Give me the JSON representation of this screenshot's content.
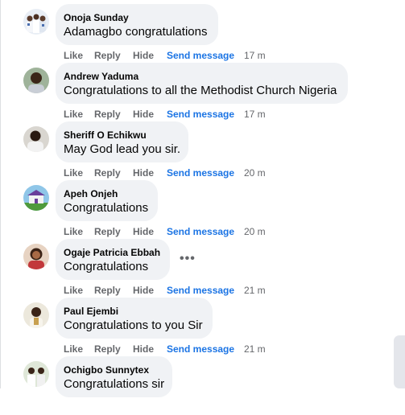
{
  "actions": {
    "like": "Like",
    "reply": "Reply",
    "hide": "Hide",
    "send_message": "Send message"
  },
  "comments": [
    {
      "author": "Onoja Sunday",
      "text": "Adamagbo congratulations",
      "time": "17 m",
      "avatar_icon": "group-photo-avatar-icon"
    },
    {
      "author": "Andrew Yaduma",
      "text": "Congratulations to all the Methodist Church Nigeria",
      "time": "17 m",
      "avatar_icon": "portrait-avatar-icon"
    },
    {
      "author": "Sheriff O Echikwu",
      "text": "May God lead you sir.",
      "time": "20 m",
      "avatar_icon": "portrait-avatar-icon"
    },
    {
      "author": "Apeh Onjeh",
      "text": "Congratulations",
      "time": "20 m",
      "avatar_icon": "church-building-avatar-icon"
    },
    {
      "author": "Ogaje Patricia Ebbah",
      "text": "Congratulations",
      "time": "21 m",
      "avatar_icon": "portrait-avatar-icon"
    },
    {
      "author": "Paul Ejembi",
      "text": "Congratulations to you Sir",
      "time": "21 m",
      "avatar_icon": "portrait-avatar-icon"
    },
    {
      "author": "Ochigbo Sunnytex",
      "text": "Congratulations sir",
      "time": "",
      "avatar_icon": "group-photo-avatar-icon"
    }
  ],
  "colors": {
    "bubble": "#f0f2f5",
    "action_gray": "#65676b",
    "send_message_blue": "#1b74e4"
  }
}
